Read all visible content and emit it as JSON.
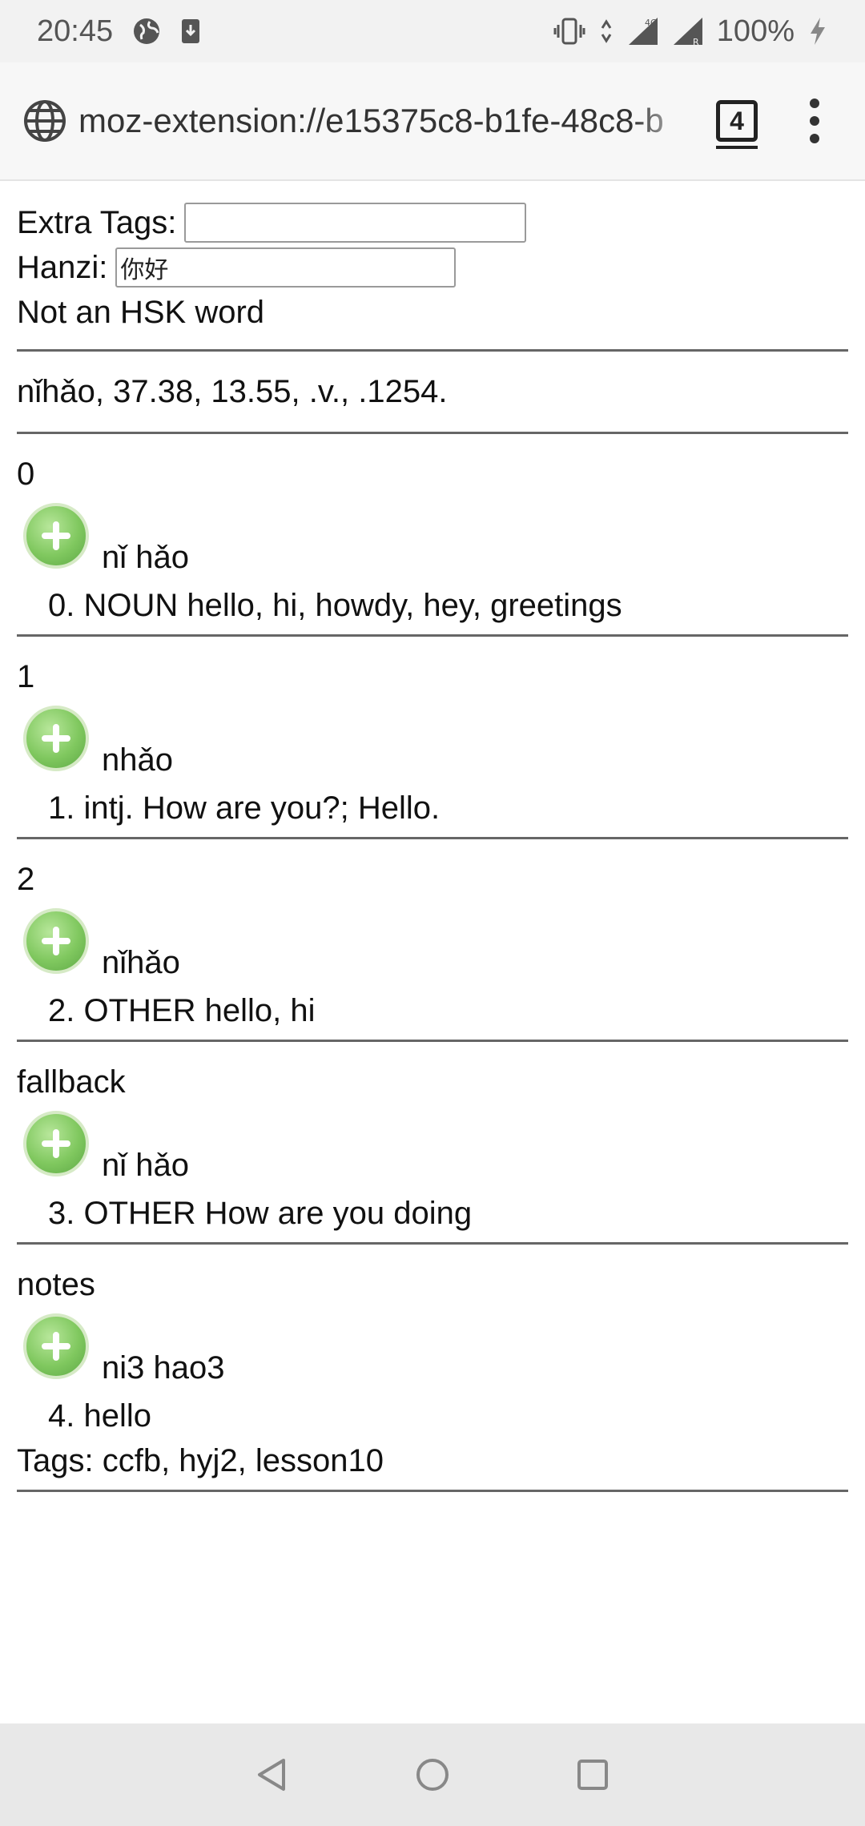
{
  "status_bar": {
    "time": "20:45",
    "left_icons": [
      "globe-icon",
      "download-icon"
    ],
    "right_icons": [
      "vibrate-icon",
      "4g-data-icon",
      "signal-icon",
      "roaming-signal-icon"
    ],
    "battery": "100%",
    "battery_icon": "charging-icon"
  },
  "toolbar": {
    "url": "moz-extension://e15375c8-b1fe-48c8-b",
    "tab_count": "4"
  },
  "form": {
    "extra_tags_label": "Extra Tags:",
    "extra_tags_value": "",
    "hanzi_label": "Hanzi:",
    "hanzi_value": "你好"
  },
  "hsk_status": "Not an HSK word",
  "frequency_line": "nǐhǎo, 37.38, 13.55, .v., .1254.",
  "entries": [
    {
      "heading": "0",
      "pinyin": "nǐ hǎo",
      "definition": "0. NOUN hello, hi, howdy, hey, greetings"
    },
    {
      "heading": "1",
      "pinyin": "nhǎo",
      "definition": "1. intj. How are you?; Hello."
    },
    {
      "heading": "2",
      "pinyin": "nǐhǎo",
      "definition": "2. OTHER hello, hi"
    },
    {
      "heading": "fallback",
      "pinyin": "nǐ hǎo",
      "definition": "3. OTHER How are you doing"
    },
    {
      "heading": "notes",
      "pinyin": "ni3 hao3",
      "definition": "4. hello",
      "tags": "Tags: ccfb, hyj2, lesson10"
    }
  ],
  "colors": {
    "add_button": "#80c85f",
    "separator": "#666666",
    "status_bar_bg": "#f2f2f2",
    "nav_bar_bg": "#e8e8e8"
  }
}
